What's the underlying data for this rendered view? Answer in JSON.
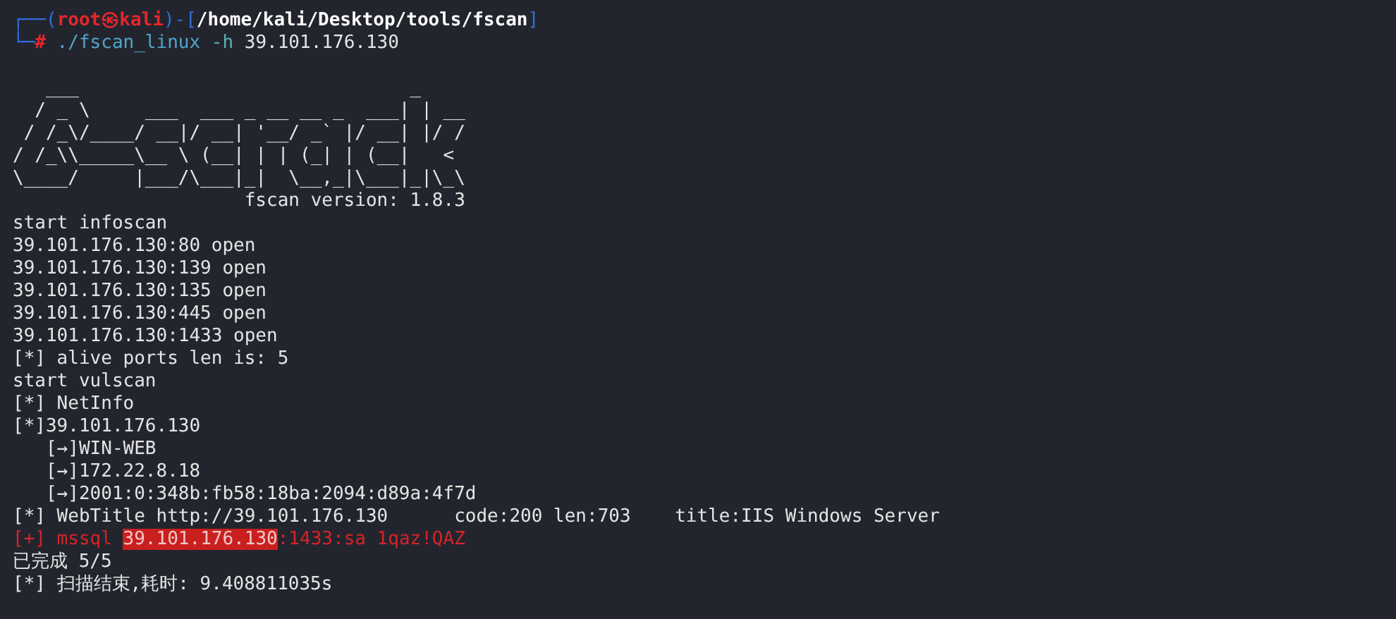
{
  "terminal": {
    "prompt": [
      {
        "kind": "frame",
        "text": "┌──("
      },
      {
        "kind": "user",
        "text": "root㉿kali"
      },
      {
        "kind": "frame",
        "text": ")-["
      },
      {
        "kind": "path",
        "text": "/home/kali/Desktop/tools/fscan"
      },
      {
        "kind": "frame",
        "text": "]"
      }
    ],
    "command": [
      {
        "kind": "frame",
        "text": "└─"
      },
      {
        "kind": "user",
        "text": "#"
      },
      {
        "kind": "command",
        "text": " ./fscan_linux"
      },
      {
        "kind": "option",
        "text": " -h"
      },
      {
        "kind": "plain",
        "text": " 39.101.176.130"
      }
    ],
    "banner": [
      "   ___                              _    ",
      "  / _ \\     ___  ___ _ __ __ _  ___| | __ ",
      " / /_\\/____/ __|/ __| '__/ _` |/ __| |/ /",
      "/ /_\\\\_____\\__ \\ (__| | | (_| | (__|   <    ",
      "\\____/     |___/\\___|_|  \\__,_|\\___|_|\\_\\   ",
      "                     fscan version: 1.8.3"
    ],
    "output": [
      {
        "segments": [
          {
            "kind": "plain",
            "text": "start infoscan"
          }
        ]
      },
      {
        "segments": [
          {
            "kind": "plain",
            "text": "39.101.176.130:80 open"
          }
        ]
      },
      {
        "segments": [
          {
            "kind": "plain",
            "text": "39.101.176.130:139 open"
          }
        ]
      },
      {
        "segments": [
          {
            "kind": "plain",
            "text": "39.101.176.130:135 open"
          }
        ]
      },
      {
        "segments": [
          {
            "kind": "plain",
            "text": "39.101.176.130:445 open"
          }
        ]
      },
      {
        "segments": [
          {
            "kind": "plain",
            "text": "39.101.176.130:1433 open"
          }
        ]
      },
      {
        "segments": [
          {
            "kind": "plain",
            "text": "[*] alive ports len is: 5"
          }
        ]
      },
      {
        "segments": [
          {
            "kind": "plain",
            "text": "start vulscan"
          }
        ]
      },
      {
        "segments": [
          {
            "kind": "plain",
            "text": "[*] NetInfo"
          }
        ]
      },
      {
        "segments": [
          {
            "kind": "plain",
            "text": "[*]39.101.176.130"
          }
        ]
      },
      {
        "segments": [
          {
            "kind": "plain",
            "text": "   [→]WIN-WEB"
          }
        ]
      },
      {
        "segments": [
          {
            "kind": "plain",
            "text": "   [→]172.22.8.18"
          }
        ]
      },
      {
        "segments": [
          {
            "kind": "plain",
            "text": "   [→]2001:0:348b:fb58:18ba:2094:d89a:4f7d"
          }
        ]
      },
      {
        "segments": [
          {
            "kind": "plain",
            "text": "[*] WebTitle http://39.101.176.130      code:200 len:703    title:IIS Windows Server"
          }
        ]
      },
      {
        "segments": [
          {
            "kind": "alert",
            "text": "[+] mssql "
          },
          {
            "kind": "highlight",
            "text": "39.101.176.130"
          },
          {
            "kind": "alert",
            "text": ":1433:sa 1qaz!QAZ"
          }
        ]
      },
      {
        "segments": [
          {
            "kind": "plain",
            "text": "已完成 5/5"
          }
        ]
      },
      {
        "segments": [
          {
            "kind": "plain",
            "text": "[*] 扫描结束,耗时: 9.408811035s"
          }
        ]
      }
    ]
  }
}
